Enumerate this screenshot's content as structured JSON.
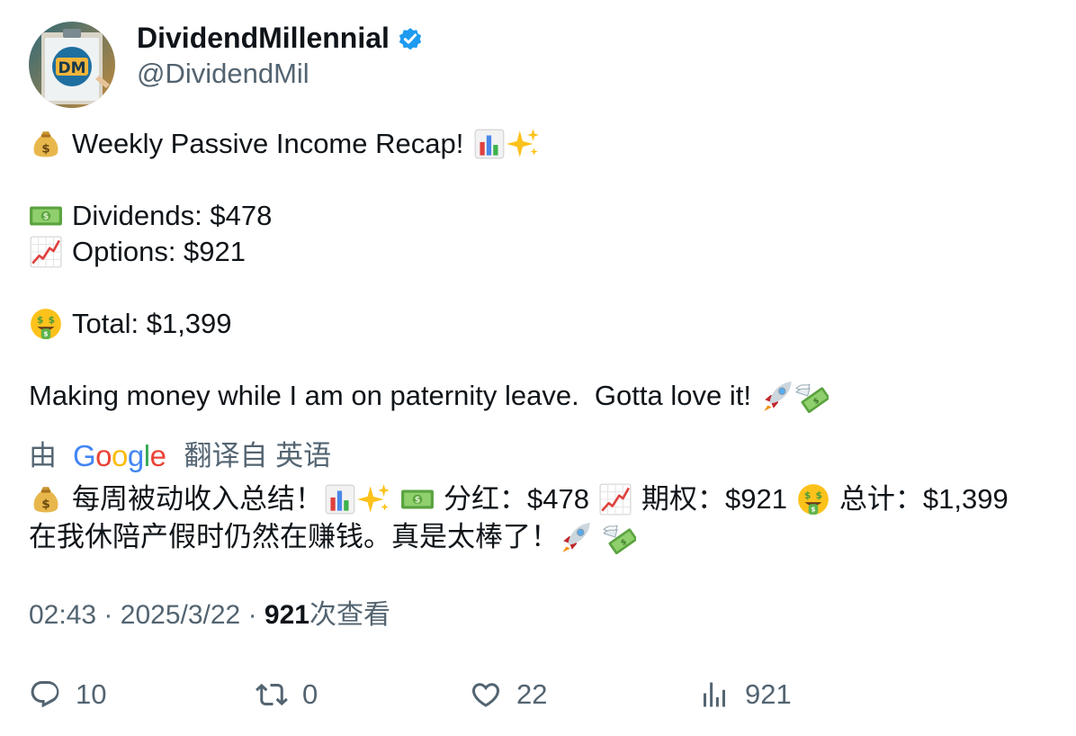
{
  "author": {
    "display_name": "DividendMillennial",
    "handle": "@DividendMil",
    "avatar_text": "DM",
    "verified_icon": "verified-badge-icon"
  },
  "tweet": {
    "line1": "Weekly Passive Income Recap!",
    "line2": "Dividends: $478",
    "line3": "Options: $921",
    "line4": "Total: $1,399",
    "line5": "Making money while I am on paternity leave.  Gotta love it!"
  },
  "translation": {
    "by_label": "由",
    "google_word": "Google",
    "from_label": "翻译自 英语",
    "part1": "每周被动收入总结！",
    "part2": "分红：$478",
    "part3": "期权：$921",
    "part4": "总计：$1,399",
    "line2": "在我休陪产假时仍然在赚钱。真是太棒了！"
  },
  "meta": {
    "time": "02:43",
    "separator": "·",
    "date": "2025/3/22",
    "views_count": "921",
    "views_label": "次查看"
  },
  "actions": {
    "replies": "10",
    "retweets": "0",
    "likes": "22",
    "views": "921"
  },
  "colors": {
    "text_primary": "#0f1419",
    "text_secondary": "#536471",
    "verified_blue": "#1d9bf0",
    "google_blue": "#4285f4",
    "google_red": "#ea4335",
    "google_yellow": "#fbbc05",
    "google_green": "#34a853"
  }
}
